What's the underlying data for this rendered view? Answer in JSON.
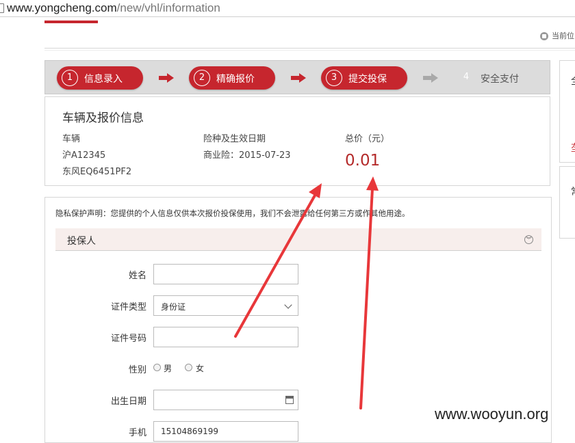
{
  "browser": {
    "url_host": "www.yongcheng.com",
    "url_path": "/new/vhl/information"
  },
  "breadcrumb": {
    "label": "当前位"
  },
  "steps": [
    {
      "num": "1",
      "label": "信息录入"
    },
    {
      "num": "2",
      "label": "精确报价"
    },
    {
      "num": "3",
      "label": "提交投保"
    },
    {
      "num": "4",
      "label": "安全支付"
    }
  ],
  "vehicle_info": {
    "title": "车辆及报价信息",
    "vehicle_label": "车辆",
    "plate": "沪A12345",
    "model": "东风EQ6451PF2",
    "insurance_label": "险种及生效日期",
    "insurance_value": "商业险：2015-07-23",
    "total_label": "总价（元）",
    "total_value": "0.01"
  },
  "right_panel": {
    "c1": "全",
    "c2": "垄",
    "c3": "常"
  },
  "privacy": "隐私保护声明：您提供的个人信息仅供本次报价投保使用，我们不会泄露给任何第三方或作其他用途。",
  "section": {
    "title": "投保人"
  },
  "form": {
    "name_label": "姓名",
    "id_type_label": "证件类型",
    "id_type_value": "身份证",
    "id_number_label": "证件号码",
    "gender_label": "性别",
    "gender_male": "男",
    "gender_female": "女",
    "birth_label": "出生日期",
    "phone_label": "手机",
    "phone_value": "15104869199"
  },
  "watermark": "www.wooyun.org",
  "colors": {
    "accent": "#c6262e",
    "price": "#b42a2a",
    "annotation": "#e8373a"
  }
}
